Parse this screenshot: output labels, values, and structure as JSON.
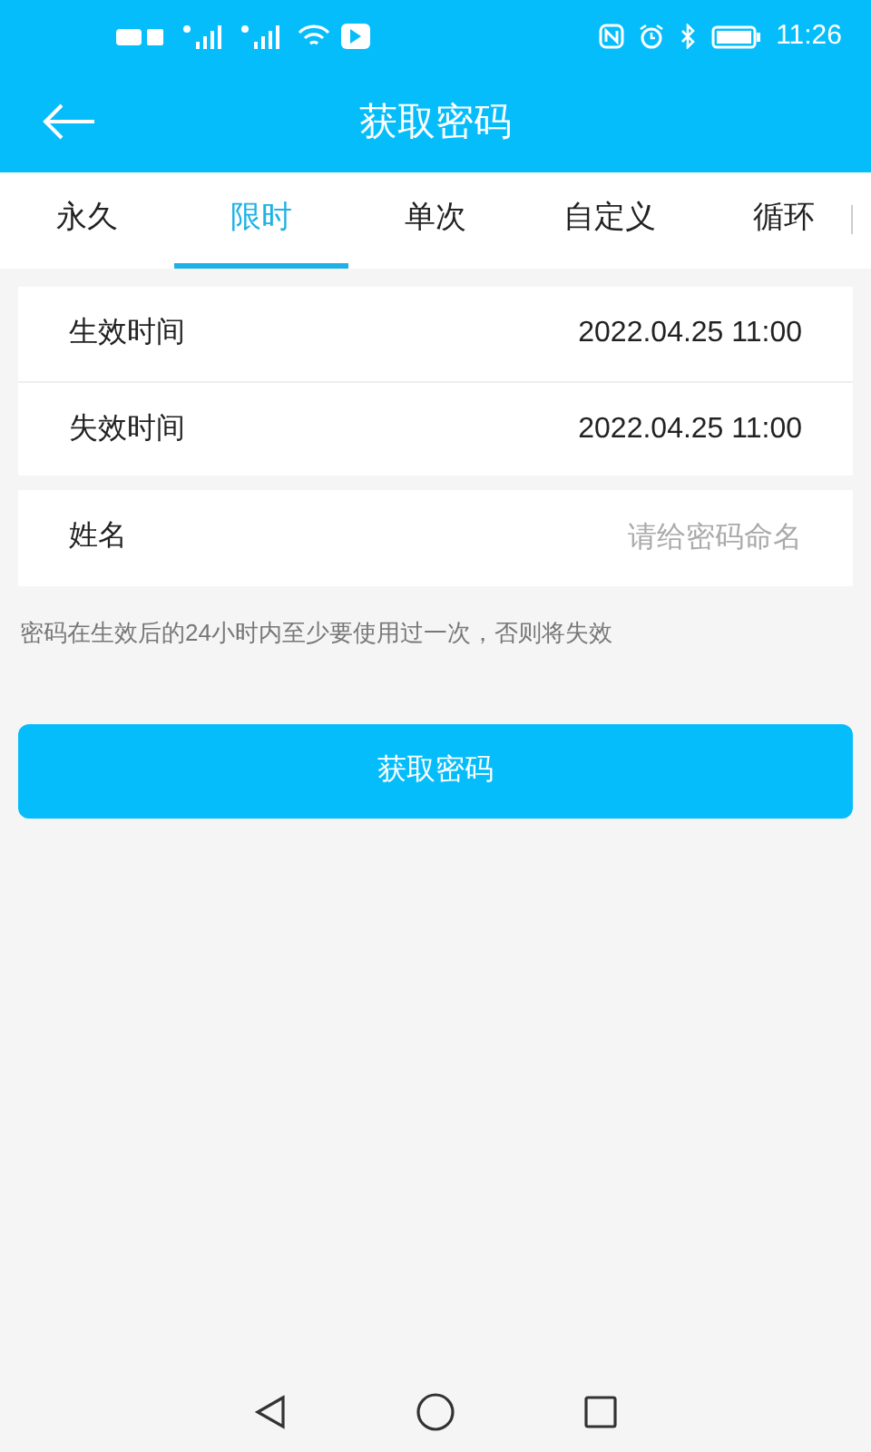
{
  "status_bar": {
    "time": "11:26"
  },
  "header": {
    "title": "获取密码"
  },
  "tabs": [
    {
      "label": "永久",
      "selected": false
    },
    {
      "label": "限时",
      "selected": true
    },
    {
      "label": "单次",
      "selected": false
    },
    {
      "label": "自定义",
      "selected": false
    },
    {
      "label": "循环",
      "selected": false
    }
  ],
  "time_rows": [
    {
      "label": "生效时间",
      "value": "2022.04.25 11:00"
    },
    {
      "label": "失效时间",
      "value": "2022.04.25 11:00"
    }
  ],
  "name_field": {
    "label": "姓名",
    "placeholder": "请给密码命名"
  },
  "hint": "密码在生效后的24小时内至少要使用过一次，否则将失效",
  "submit_button": "获取密码"
}
